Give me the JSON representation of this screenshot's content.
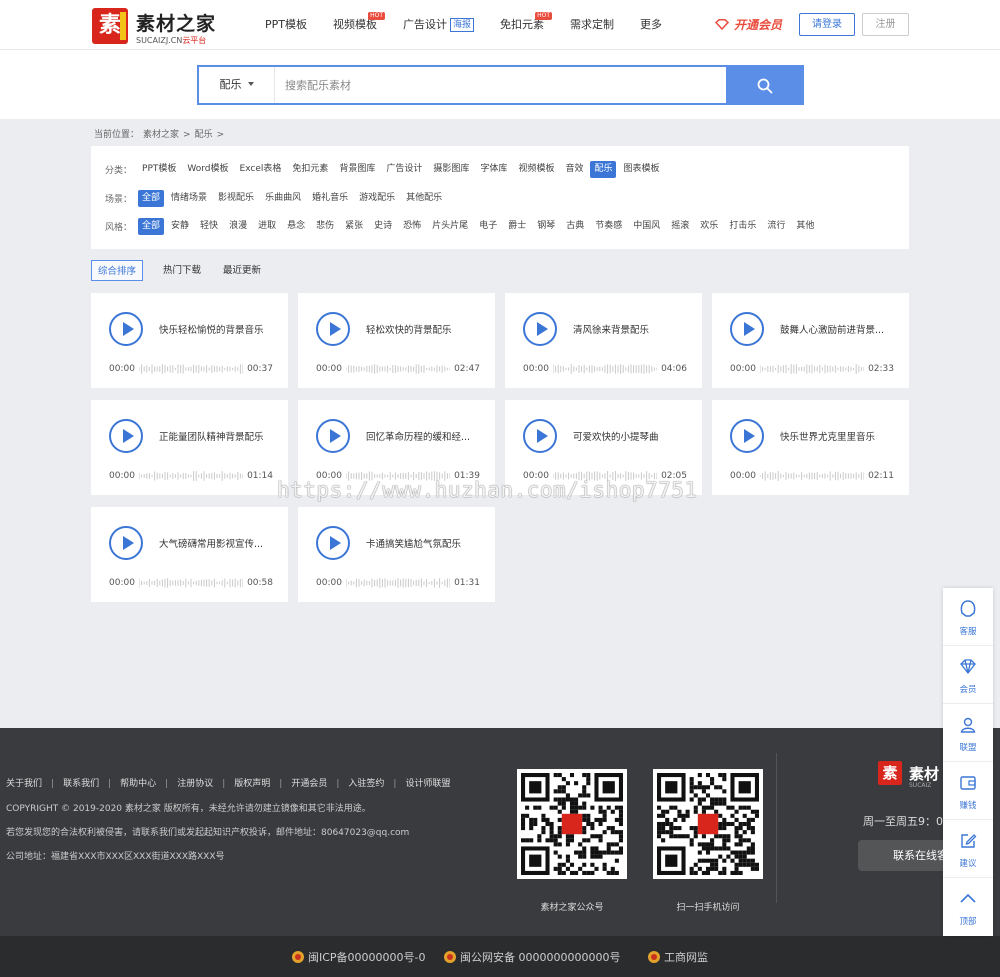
{
  "header": {
    "logo_name": "素材之家",
    "logo_char": "素",
    "logo_sub_main": "SUCAIZJ.CN",
    "logo_sub_tag": "云平台",
    "nav": [
      {
        "label": "PPT模板"
      },
      {
        "label": "视频模板",
        "hot": "HOT"
      },
      {
        "label": "广告设计",
        "tag": "海报"
      },
      {
        "label": "免扣元素",
        "hot": "HOT"
      },
      {
        "label": "需求定制"
      },
      {
        "label": "更多"
      }
    ],
    "vip_label": "开通会员",
    "login_label": "请登录",
    "register_label": "注册"
  },
  "search": {
    "category": "配乐",
    "placeholder": "搜索配乐素材",
    "value": ""
  },
  "breadcrumb": [
    "当前位置：",
    "素材之家",
    ">",
    "配乐",
    ">"
  ],
  "filters": {
    "category": {
      "label": "分类：",
      "items": [
        "PPT模板",
        "Word模板",
        "Excel表格",
        "免扣元素",
        "背景图库",
        "广告设计",
        "摄影图库",
        "字体库",
        "视频模板",
        "音效",
        "配乐",
        "图表模板"
      ],
      "active": "配乐"
    },
    "scene": {
      "label": "场景：",
      "items": [
        "全部",
        "情绪场景",
        "影视配乐",
        "乐曲曲风",
        "婚礼音乐",
        "游戏配乐",
        "其他配乐"
      ],
      "active": "全部"
    },
    "style": {
      "label": "风格：",
      "items": [
        "全部",
        "安静",
        "轻快",
        "浪漫",
        "进取",
        "悬念",
        "悲伤",
        "紧张",
        "史诗",
        "恐怖",
        "片头片尾",
        "电子",
        "爵士",
        "钢琴",
        "古典",
        "节奏感",
        "中国风",
        "摇滚",
        "欢乐",
        "打击乐",
        "流行",
        "其他"
      ],
      "active": "全部"
    }
  },
  "sort": {
    "tabs": [
      "综合排序",
      "热门下载",
      "最近更新"
    ],
    "active": "综合排序"
  },
  "tracks": [
    {
      "title": "快乐轻松愉悦的背景音乐",
      "start": "00:00",
      "duration": "00:37"
    },
    {
      "title": "轻松欢快的背景配乐",
      "start": "00:00",
      "duration": "02:47"
    },
    {
      "title": "清风徐来背景配乐",
      "start": "00:00",
      "duration": "04:06"
    },
    {
      "title": "鼓舞人心激励前进背景...",
      "start": "00:00",
      "duration": "02:33"
    },
    {
      "title": "正能量团队精神背景配乐",
      "start": "00:00",
      "duration": "01:14"
    },
    {
      "title": "回忆革命历程的缓和经...",
      "start": "00:00",
      "duration": "01:39"
    },
    {
      "title": "可爱欢快的小提琴曲",
      "start": "00:00",
      "duration": "02:05"
    },
    {
      "title": "快乐世界尤克里里音乐",
      "start": "00:00",
      "duration": "02:11"
    },
    {
      "title": "大气磅礴常用影视宣传...",
      "start": "00:00",
      "duration": "00:58"
    },
    {
      "title": "卡通搞笑尴尬气氛配乐",
      "start": "00:00",
      "duration": "01:31"
    }
  ],
  "footer": {
    "links": [
      "关于我们",
      "联系我们",
      "帮助中心",
      "注册协议",
      "版权声明",
      "开通会员",
      "入驻签约",
      "设计师联盟"
    ],
    "copyright": "COPYRIGHT © 2019-2020 素材之家 版权所有，未经允许请勿建立镜像和其它非法用途。",
    "notice": "若您发现您的合法权利被侵害，请联系我们或发起起知识产权投诉，邮件地址：80647023@qq.com",
    "address": "公司地址：福建省XXX市XXX区XXX街道XXX路XXX号",
    "qr1_caption": "素材之家公众号",
    "qr2_caption": "扫一扫手机访问",
    "brand_name": "素材",
    "brand_char": "素",
    "brand_sub": "SUCAIZ",
    "hours": "周一至周五9：0",
    "contact_label": "联系在线客"
  },
  "bottom": {
    "icp": "闽ICP备00000000号-0",
    "police": "闽公网安备 0000000000000号",
    "business": "工商网监"
  },
  "sidebar": [
    {
      "label": "客服",
      "icon": "headset-icon"
    },
    {
      "label": "会员",
      "icon": "diamond-icon"
    },
    {
      "label": "联盟",
      "icon": "user-icon"
    },
    {
      "label": "赚钱",
      "icon": "wallet-icon"
    },
    {
      "label": "建议",
      "icon": "edit-icon"
    },
    {
      "label": "顶部",
      "icon": "chevron-up-icon"
    }
  ],
  "watermark": "https://www.huzhan.com/ishop7751",
  "colors": {
    "accent": "#3b76d6",
    "search_button": "#5b8ee6",
    "brand_red": "#d8261c",
    "vip_red": "#e94b3c",
    "footer_bg": "#3a3b3e"
  }
}
